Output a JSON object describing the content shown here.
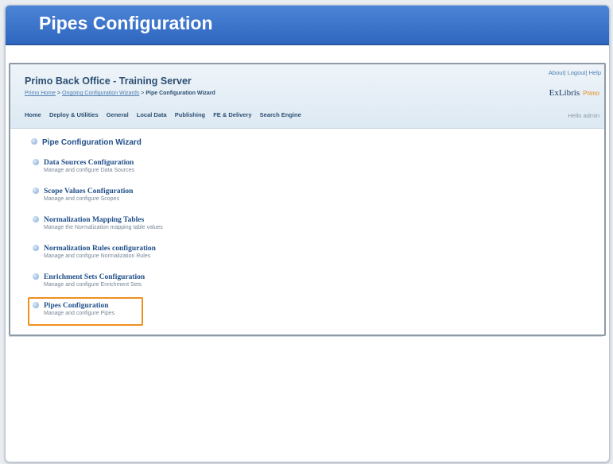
{
  "slide": {
    "title": "Pipes Configuration"
  },
  "app": {
    "title": "Primo Back Office - Training Server",
    "top_links": [
      "About",
      "Logout",
      "Help"
    ],
    "breadcrumb": [
      "Primo Home",
      "Ongoing Configuration Wizards",
      "Pipe Configuration Wizard"
    ],
    "logo_text": "ExLibris",
    "logo_product": "Primo",
    "nav": [
      "Home",
      "Deploy & Utilities",
      "General",
      "Local Data",
      "Publishing",
      "FE & Delivery",
      "Search Engine"
    ],
    "greeting": "Hello  admin"
  },
  "wizard": {
    "heading": "Pipe Configuration Wizard",
    "items": [
      {
        "title": "Data Sources Configuration",
        "desc": "Manage and configure Data Sources"
      },
      {
        "title": "Scope Values Configuration",
        "desc": "Manage and configure Scopes"
      },
      {
        "title": "Normalization Mapping Tables",
        "desc": "Manage the Normalization mapping table values"
      },
      {
        "title": "Normalization Rules configuration",
        "desc": "Manage and configure Normalization Rules"
      },
      {
        "title": "Enrichment Sets Configuration",
        "desc": "Manage and configure Enrichment Sets"
      },
      {
        "title": "Pipes Configuration",
        "desc": "Manage and configure Pipes"
      }
    ]
  },
  "colors": {
    "title_bar": "#3a74cc",
    "highlight": "#f08f22",
    "link": "#1f4e8a"
  }
}
